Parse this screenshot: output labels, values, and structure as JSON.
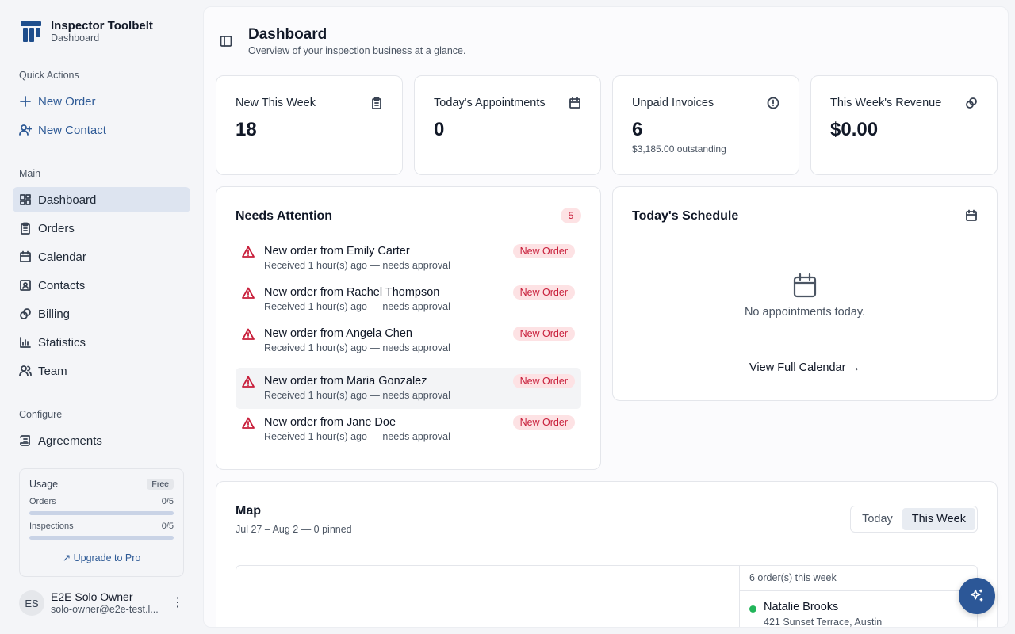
{
  "brand": {
    "title": "Inspector Toolbelt",
    "subtitle": "Dashboard"
  },
  "sidebar": {
    "quick_actions_label": "Quick Actions",
    "quick_actions": [
      {
        "label": "New Order",
        "icon": "plus-icon"
      },
      {
        "label": "New Contact",
        "icon": "user-plus-icon"
      }
    ],
    "main_label": "Main",
    "main_items": [
      {
        "label": "Dashboard",
        "icon": "layout-grid-icon"
      },
      {
        "label": "Orders",
        "icon": "clipboard-icon"
      },
      {
        "label": "Calendar",
        "icon": "calendar-icon"
      },
      {
        "label": "Contacts",
        "icon": "contact-card-icon"
      },
      {
        "label": "Billing",
        "icon": "coins-icon"
      },
      {
        "label": "Statistics",
        "icon": "bar-chart-icon"
      },
      {
        "label": "Team",
        "icon": "users-icon"
      }
    ],
    "configure_label": "Configure",
    "configure_items": [
      {
        "label": "Agreements",
        "icon": "scroll-icon"
      }
    ],
    "usage": {
      "title": "Usage",
      "plan": "Free",
      "orders_label": "Orders",
      "orders_value": "0/5",
      "orders_fraction": 0,
      "inspections_label": "Inspections",
      "inspections_value": "0/5",
      "inspections_fraction": 0,
      "upgrade_label": "Upgrade to Pro"
    },
    "user": {
      "initials": "ES",
      "name": "E2E Solo Owner",
      "email": "solo-owner@e2e-test.l..."
    }
  },
  "header": {
    "title": "Dashboard",
    "subtitle": "Overview of your inspection business at a glance."
  },
  "stats": [
    {
      "title": "New This Week",
      "value": "18",
      "note": "",
      "icon": "clipboard-icon"
    },
    {
      "title": "Today's Appointments",
      "value": "0",
      "note": "",
      "icon": "calendar-icon"
    },
    {
      "title": "Unpaid Invoices",
      "value": "6",
      "note": "$3,185.00 outstanding",
      "icon": "alert-circle-icon"
    },
    {
      "title": "This Week's Revenue",
      "value": "$0.00",
      "note": "",
      "icon": "coins-icon"
    }
  ],
  "attention": {
    "title": "Needs Attention",
    "count": "5",
    "items": [
      {
        "title": "New order from Emily Carter",
        "sub": "Received 1 hour(s) ago — needs approval",
        "badge": "New Order"
      },
      {
        "title": "New order from Rachel Thompson",
        "sub": "Received 1 hour(s) ago — needs approval",
        "badge": "New Order"
      },
      {
        "title": "New order from Angela Chen",
        "sub": "Received 1 hour(s) ago — needs approval",
        "badge": "New Order"
      },
      {
        "title": "New order from Maria Gonzalez",
        "sub": "Received 1 hour(s) ago — needs approval",
        "badge": "New Order"
      },
      {
        "title": "New order from Jane Doe",
        "sub": "Received 1 hour(s) ago — needs approval",
        "badge": "New Order"
      }
    ]
  },
  "schedule": {
    "title": "Today's Schedule",
    "empty_text": "No appointments today.",
    "link_label": "View Full Calendar →"
  },
  "map": {
    "title": "Map",
    "subtitle": "Jul 27 – Aug 2 — 0 pinned",
    "tabs": [
      {
        "label": "Today",
        "active": false
      },
      {
        "label": "This Week",
        "active": true
      }
    ],
    "orders_count": "6 order(s) this week",
    "orders": [
      {
        "name": "Natalie Brooks",
        "address": "421 Sunset Terrace, Austin"
      }
    ]
  },
  "colors": {
    "accent": "#2c5797",
    "danger": "#c81e3a",
    "danger_bg": "#fde2e4",
    "active_nav": "#dde4f0",
    "status_green": "#22b55a"
  }
}
